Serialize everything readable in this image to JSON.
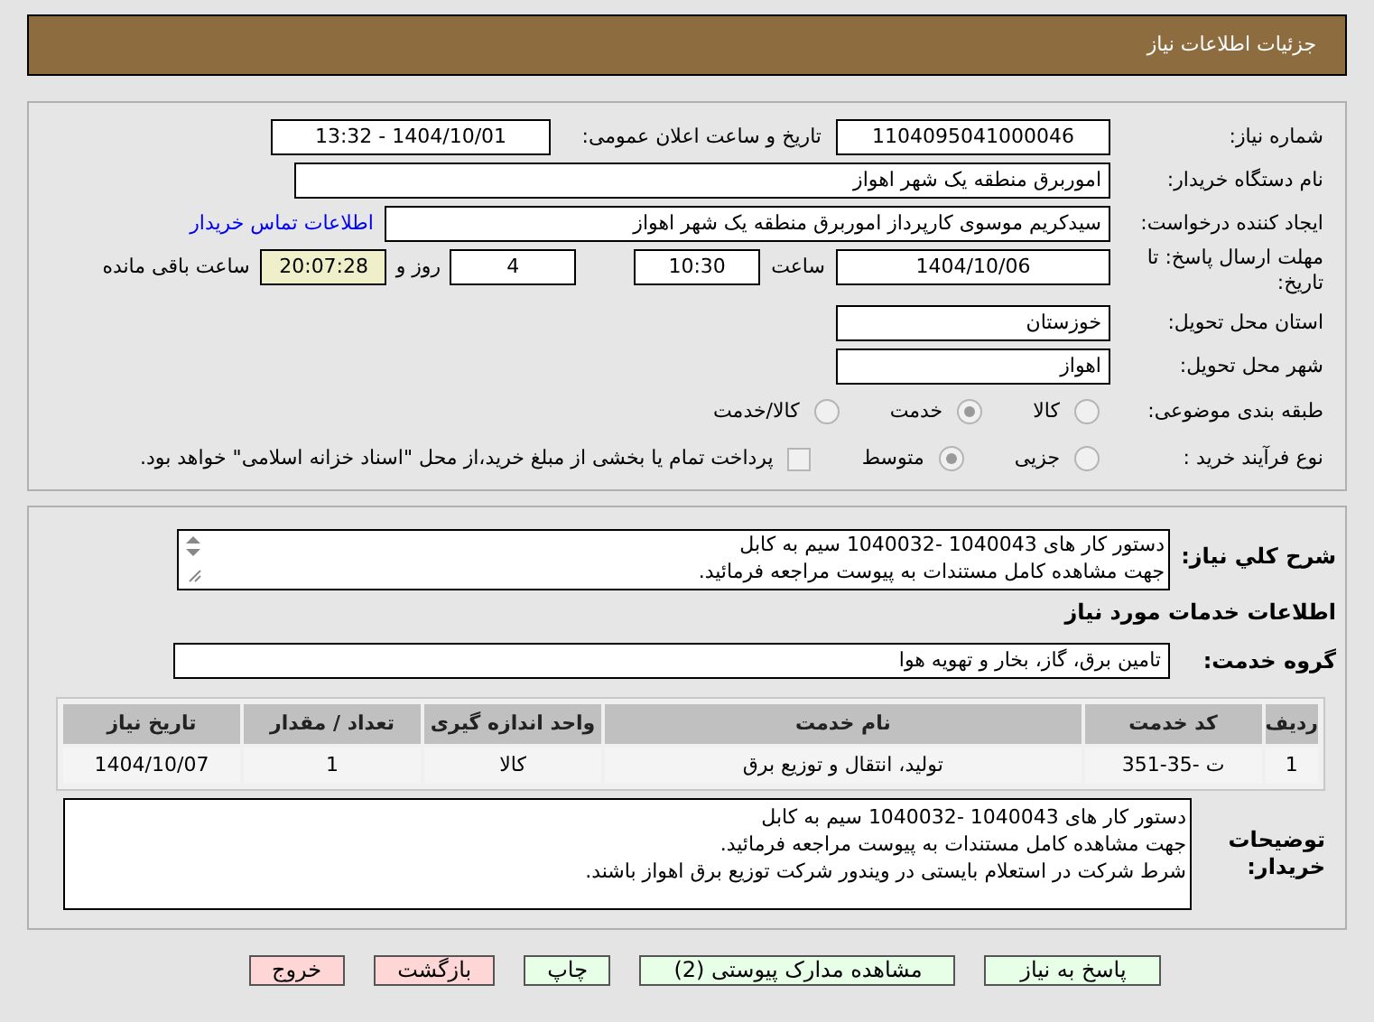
{
  "header": {
    "title": "جزئیات اطلاعات نیاز"
  },
  "need_number": {
    "label": "شماره نیاز:",
    "value": "1104095041000046"
  },
  "announce": {
    "label": "تاریخ و ساعت اعلان عمومی:",
    "value": "1404/10/01 - 13:32"
  },
  "buyer": {
    "label": "نام دستگاه خریدار:",
    "value": "اموربرق منطقه یک شهر اهواز"
  },
  "creator": {
    "label": "ایجاد کننده درخواست:",
    "value": "سیدکریم موسوی کارپرداز اموربرق منطقه یک شهر اهواز",
    "link": "اطلاعات تماس خریدار"
  },
  "deadline": {
    "label": "مهلت ارسال پاسخ: تا تاریخ:",
    "date": "1404/10/06",
    "time_label": "ساعت",
    "time": "10:30",
    "days": "4",
    "days_label": "روز و",
    "remaining": "20:07:28",
    "remaining_label": "ساعت باقی مانده"
  },
  "province": {
    "label": "استان محل تحویل:",
    "value": "خوزستان"
  },
  "city": {
    "label": "شهر محل تحویل:",
    "value": "اهواز"
  },
  "category": {
    "label": "طبقه بندی موضوعی:",
    "options": [
      {
        "label": "کالا",
        "selected": false
      },
      {
        "label": "خدمت",
        "selected": true
      },
      {
        "label": "کالا/خدمت",
        "selected": false
      }
    ]
  },
  "process": {
    "label": "نوع فرآیند خرید :",
    "options": [
      {
        "label": "جزیی",
        "selected": false
      },
      {
        "label": "متوسط",
        "selected": true
      }
    ],
    "payment": {
      "label": "پرداخت تمام یا بخشی از مبلغ خرید،از محل \"اسناد خزانه اسلامی\" خواهد بود.",
      "checked": false
    }
  },
  "description": {
    "label": "شرح کلي نیاز:",
    "lines": [
      "دستور کار های 1040043 -1040032 سیم به کابل",
      "جهت مشاهده کامل مستندات به پیوست مراجعه فرمائید."
    ]
  },
  "services_title": "اطلاعات خدمات مورد نیاز",
  "service_group": {
    "label": "گروه خدمت:",
    "value": "تامین برق، گاز، بخار و تهویه هوا"
  },
  "table": {
    "columns": [
      "ردیف",
      "کد خدمت",
      "نام خدمت",
      "واحد اندازه گیری",
      "تعداد / مقدار",
      "تاریخ نیاز"
    ],
    "rows": [
      [
        "1",
        "ت -35-351",
        "تولید، انتقال و توزیع برق",
        "کالا",
        "1",
        "1404/10/07"
      ]
    ]
  },
  "buyer_notes": {
    "label": "توضیحات خریدار:",
    "lines": [
      "دستور کار های 1040043 -1040032 سیم به کابل",
      "جهت مشاهده کامل مستندات به پیوست مراجعه فرمائید.",
      "شرط شرکت در استعلام بایستی در ویندور شرکت توزیع برق اهواز باشند."
    ]
  },
  "buttons": [
    {
      "label": "پاسخ به نیاز",
      "kind": "green"
    },
    {
      "label": "مشاهده مدارک پیوستی (2)",
      "kind": "green"
    },
    {
      "label": "چاپ",
      "kind": "green"
    },
    {
      "label": "بازگشت",
      "kind": "red"
    },
    {
      "label": "خروج",
      "kind": "red"
    }
  ]
}
